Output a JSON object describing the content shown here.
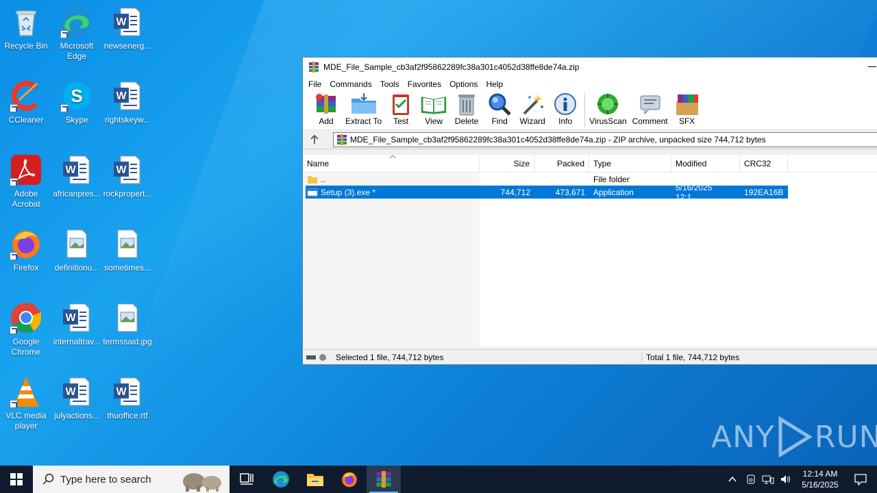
{
  "desktop": {
    "icons": [
      {
        "label": "Recycle Bin",
        "icon": "recycle-bin-icon"
      },
      {
        "label": "Microsoft Edge",
        "icon": "edge-icon"
      },
      {
        "label": "newsenerg...",
        "icon": "word-doc-icon"
      },
      {
        "label": "CCleaner",
        "icon": "ccleaner-icon"
      },
      {
        "label": "Skype",
        "icon": "skype-icon"
      },
      {
        "label": "rightskeyw...",
        "icon": "word-doc-icon"
      },
      {
        "label": "Adobe Acrobat",
        "icon": "acrobat-icon"
      },
      {
        "label": "africanpres...",
        "icon": "word-doc-icon"
      },
      {
        "label": "rockpropert...",
        "icon": "word-doc-icon"
      },
      {
        "label": "Firefox",
        "icon": "firefox-icon"
      },
      {
        "label": "definitionu...",
        "icon": "image-file-icon"
      },
      {
        "label": "sometimes...",
        "icon": "image-file-icon"
      },
      {
        "label": "Google Chrome",
        "icon": "chrome-icon"
      },
      {
        "label": "internaltrav...",
        "icon": "word-doc-icon"
      },
      {
        "label": "termssaid.jpg",
        "icon": "image-file-icon"
      },
      {
        "label": "VLC media player",
        "icon": "vlc-icon"
      },
      {
        "label": "julyactions...",
        "icon": "word-doc-icon"
      },
      {
        "label": "thuoffice.rtf",
        "icon": "word-doc-icon"
      }
    ]
  },
  "window": {
    "title": "MDE_File_Sample_cb3af2f95862289fc38a301c4052d38ffe8de74a.zip",
    "menu": [
      "File",
      "Commands",
      "Tools",
      "Favorites",
      "Options",
      "Help"
    ],
    "toolbar": [
      "Add",
      "Extract To",
      "Test",
      "View",
      "Delete",
      "Find",
      "Wizard",
      "Info",
      "VirusScan",
      "Comment",
      "SFX"
    ],
    "address": "MDE_File_Sample_cb3af2f95862289fc38a301c4052d38ffe8de74a.zip - ZIP archive, unpacked size 744,712 bytes",
    "columns": [
      "Name",
      "Size",
      "Packed",
      "Type",
      "Modified",
      "CRC32"
    ],
    "rows": [
      {
        "name": "..",
        "size": "",
        "packed": "",
        "type": "File folder",
        "modified": "",
        "crc": ""
      },
      {
        "name": "Setup (3).exe *",
        "size": "744,712",
        "packed": "473,671",
        "type": "Application",
        "modified": "5/16/2025 12:1...",
        "crc": "192EA16B"
      }
    ],
    "status_left": "Selected 1 file, 744,712 bytes",
    "status_right": "Total 1 file, 744,712 bytes"
  },
  "taskbar": {
    "search_placeholder": "Type here to search",
    "time": "12:14 AM",
    "date": "5/16/2025"
  },
  "watermark": {
    "text_left": "ANY",
    "text_right": "RUN"
  }
}
